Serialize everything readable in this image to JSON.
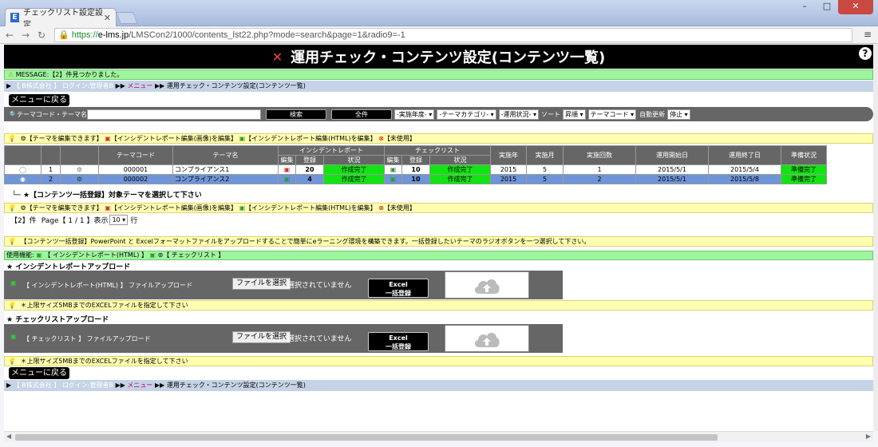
{
  "browser": {
    "tab_title": "チェックリスト設定設定",
    "favicon_letter": "E",
    "url_https": "https://",
    "url_host": "e-lms.jp",
    "url_path": "/LMSCon2/1000/contents_lst22.php?mode=search&page=1&radio9=-1"
  },
  "header": {
    "title": "運用チェック・コンテンツ設定(コンテンツ一覧)",
    "help": "?"
  },
  "message": "MESSAGE:【2】件見つかりました。",
  "breadcrumb": {
    "company": "【 B株式会社 】 ログイン:管理者B",
    "sep": "▶▶",
    "menu": "メニュー",
    "current": "▶▶ 運用チェック・コンテンツ設定(コンテンツ一覧)"
  },
  "back_to_menu": "メニューに戻る",
  "search": {
    "label": "テーマコード・テーマ名",
    "search_btn": "検索",
    "all_btn": "全件",
    "year": "-実施年度-",
    "category": "-テーマカテゴリ-",
    "status": "-運用状況-",
    "sort_label": "ソート",
    "sort_order": "昇順",
    "sort_key": "テーマコード",
    "auto_label": "自動更新",
    "auto_value": "停止"
  },
  "legend": {
    "edit": "【テーマを編集できます】",
    "image_edit": "【インシデントレポート編集(画像)を編集】",
    "html_edit": "【インシデントレポート編集(HTML)を編集】",
    "unused": "【未使用】"
  },
  "table": {
    "headers": {
      "theme_code": "テーマコード",
      "theme_name": "テーマ名",
      "incident": "インシデントレポート",
      "checklist": "チェックリスト",
      "edit": "編集",
      "count": "登録",
      "status": "状況",
      "year": "実施年",
      "month": "実施月",
      "times": "実施回数",
      "start": "運用開始日",
      "end": "運用終了日",
      "prep": "準備状況"
    },
    "rows": [
      {
        "no": "1",
        "code": "000001",
        "name": "コンプライアンス1",
        "inc_count": "20",
        "inc_status": "作成完了",
        "chk_count": "10",
        "chk_status": "作成完了",
        "year": "2015",
        "month": "5",
        "times": "1",
        "start": "2015/5/1",
        "end": "2015/5/4",
        "prep": "準備完了"
      },
      {
        "no": "2",
        "code": "000002",
        "name": "コンプライアンス2",
        "inc_count": "4",
        "inc_status": "作成完了",
        "chk_count": "10",
        "chk_status": "作成完了",
        "year": "2015",
        "month": "5",
        "times": "2",
        "start": "2015/5/1",
        "end": "2015/5/8",
        "prep": "準備完了"
      }
    ]
  },
  "bulk_note": "★【コンテンツ一括登録】対象テーマを選択して下さい",
  "paging": {
    "count": "【2】件",
    "page": "Page【 1 / 1 】表示",
    "per": "10",
    "rows_unit": "行"
  },
  "bulk_info": "【コンテンツ一括登録】PowerPoint と Excelフォーマットファイルをアップロードすることで簡単にeラーニング環境を構築できます。一括登録したいテーマのラジオボタンを一つ選択して下さい。",
  "usage": {
    "label": "使用機能:",
    "html": "【 インシデントレポート(HTML) 】",
    "check": "【 チェックリスト 】"
  },
  "incident_upload": {
    "section": "★ インシデントレポートアップロード",
    "label": "【 インシデントレポート(HTML) 】 ファイルアップロード",
    "choose": "ファイルを選択",
    "none": "選択されていません",
    "excel_line1": "Excel",
    "excel_line2": "一括登録",
    "hint": "＊上限サイズ5MBまでのEXCELファイルを指定して下さい"
  },
  "check_upload": {
    "section": "★ チェックリストアップロード",
    "label": "【 チェックリスト 】 ファイルアップロード",
    "choose": "ファイルを選択",
    "none": "選択されていません",
    "excel_line1": "Excel",
    "excel_line2": "一括登録",
    "hint": "＊上限サイズ5MBまでのEXCELファイルを指定して下さい"
  },
  "colors": {
    "header_bg": "#000000",
    "done_green": "#12e312",
    "selected_row": "#6f94d8",
    "note_yellow": "#ffffb0",
    "msg_green": "#9ff59f"
  }
}
